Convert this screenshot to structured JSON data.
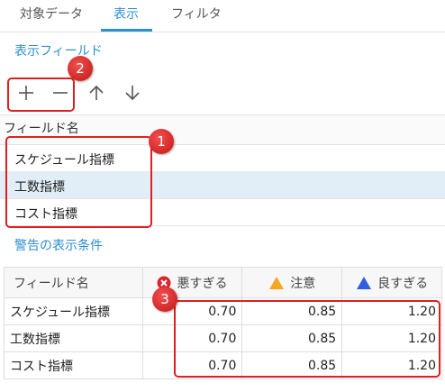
{
  "tabs": [
    {
      "label": "対象データ",
      "active": false
    },
    {
      "label": "表示",
      "active": true
    },
    {
      "label": "フィルタ",
      "active": false
    }
  ],
  "display_fields": {
    "title": "表示フィールド",
    "toolbar": {
      "add_icon": "plus-icon",
      "remove_icon": "minus-icon",
      "up_icon": "arrow-up-icon",
      "down_icon": "arrow-down-icon"
    },
    "column_header": "フィールド名",
    "items": [
      {
        "label": "スケジュール指標",
        "selected": false
      },
      {
        "label": "工数指標",
        "selected": true
      },
      {
        "label": "コスト指標",
        "selected": false
      }
    ]
  },
  "warning_conditions": {
    "title": "警告の表示条件",
    "headers": {
      "field": "フィールド名",
      "bad": "悪すぎる",
      "caution": "注意",
      "good": "良すぎる"
    },
    "rows": [
      {
        "field": "スケジュール指標",
        "bad": "0.70",
        "caution": "0.85",
        "good": "1.20"
      },
      {
        "field": "工数指標",
        "bad": "0.70",
        "caution": "0.85",
        "good": "1.20"
      },
      {
        "field": "コスト指標",
        "bad": "0.70",
        "caution": "0.85",
        "good": "1.20"
      }
    ]
  },
  "callouts": [
    "1",
    "2",
    "3"
  ],
  "colors": {
    "accent": "#2e8fd0",
    "selected_row": "#e1eef8",
    "callout": "#e02020",
    "bad_icon": "#d9262c",
    "caution_icon": "#f5a623",
    "good_icon": "#2f5fe0"
  }
}
